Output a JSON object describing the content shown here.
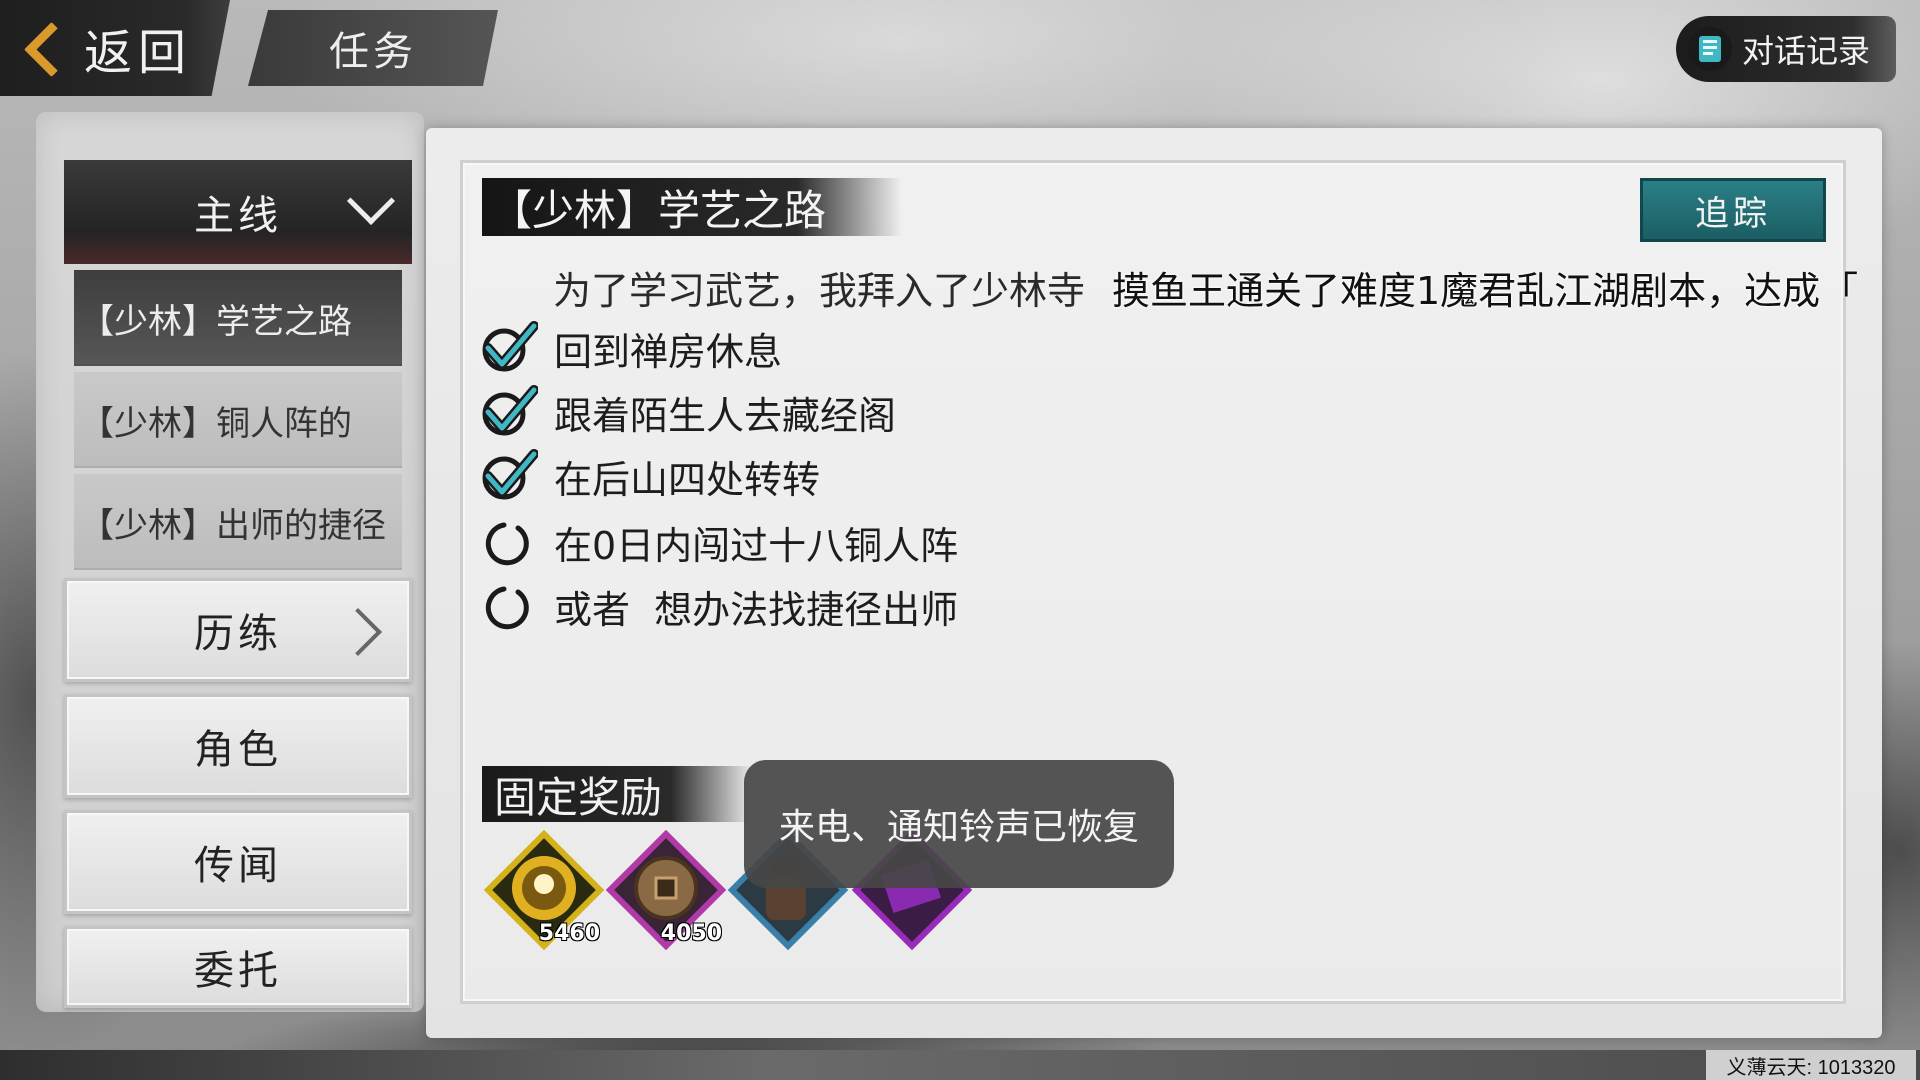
{
  "header": {
    "back_label": "返回",
    "title": "任务",
    "dialog_log_label": "对话记录"
  },
  "sidebar": {
    "main_category": "主线",
    "quests": [
      {
        "label": "【少林】学艺之路",
        "active": true
      },
      {
        "label": "【少林】铜人阵的",
        "active": false
      },
      {
        "label": "【少林】出师的捷径",
        "active": false
      }
    ],
    "categories": [
      "历练",
      "角色",
      "传闻",
      "委托"
    ]
  },
  "quest": {
    "title": "【少林】学艺之路",
    "track_label": "追踪",
    "description": "为了学习武艺，我拜入了少林寺",
    "overlay_text": "摸鱼王通关了难度1魔君乱江湖剧本，达成「",
    "objectives": [
      {
        "text": "回到禅房休息",
        "done": true
      },
      {
        "text": "跟着陌生人去藏经阁",
        "done": true
      },
      {
        "text": "在后山四处转转",
        "done": true
      },
      {
        "text": "在0日内闯过十八铜人阵",
        "done": false
      },
      {
        "text": "或者  想办法找捷径出师",
        "done": false
      }
    ]
  },
  "rewards": {
    "heading": "固定奖励",
    "items": [
      {
        "icon": "experience-orb-icon",
        "count": "5460",
        "color": "#d4b21c"
      },
      {
        "icon": "copper-coin-icon",
        "count": "4050",
        "color": "#b23aa8"
      },
      {
        "icon": "backpack-icon",
        "count": "",
        "color": "#3a7fa8"
      },
      {
        "icon": "purple-book-icon",
        "count": "",
        "color": "#9a2ab8"
      }
    ]
  },
  "toast": "来电、通知铃声已恢复",
  "watermark": "义薄云天: 1013320",
  "colors": {
    "accent_teal": "#1f6e75",
    "check_teal": "#3fb8c4",
    "back_orange": "#d99a2b"
  }
}
